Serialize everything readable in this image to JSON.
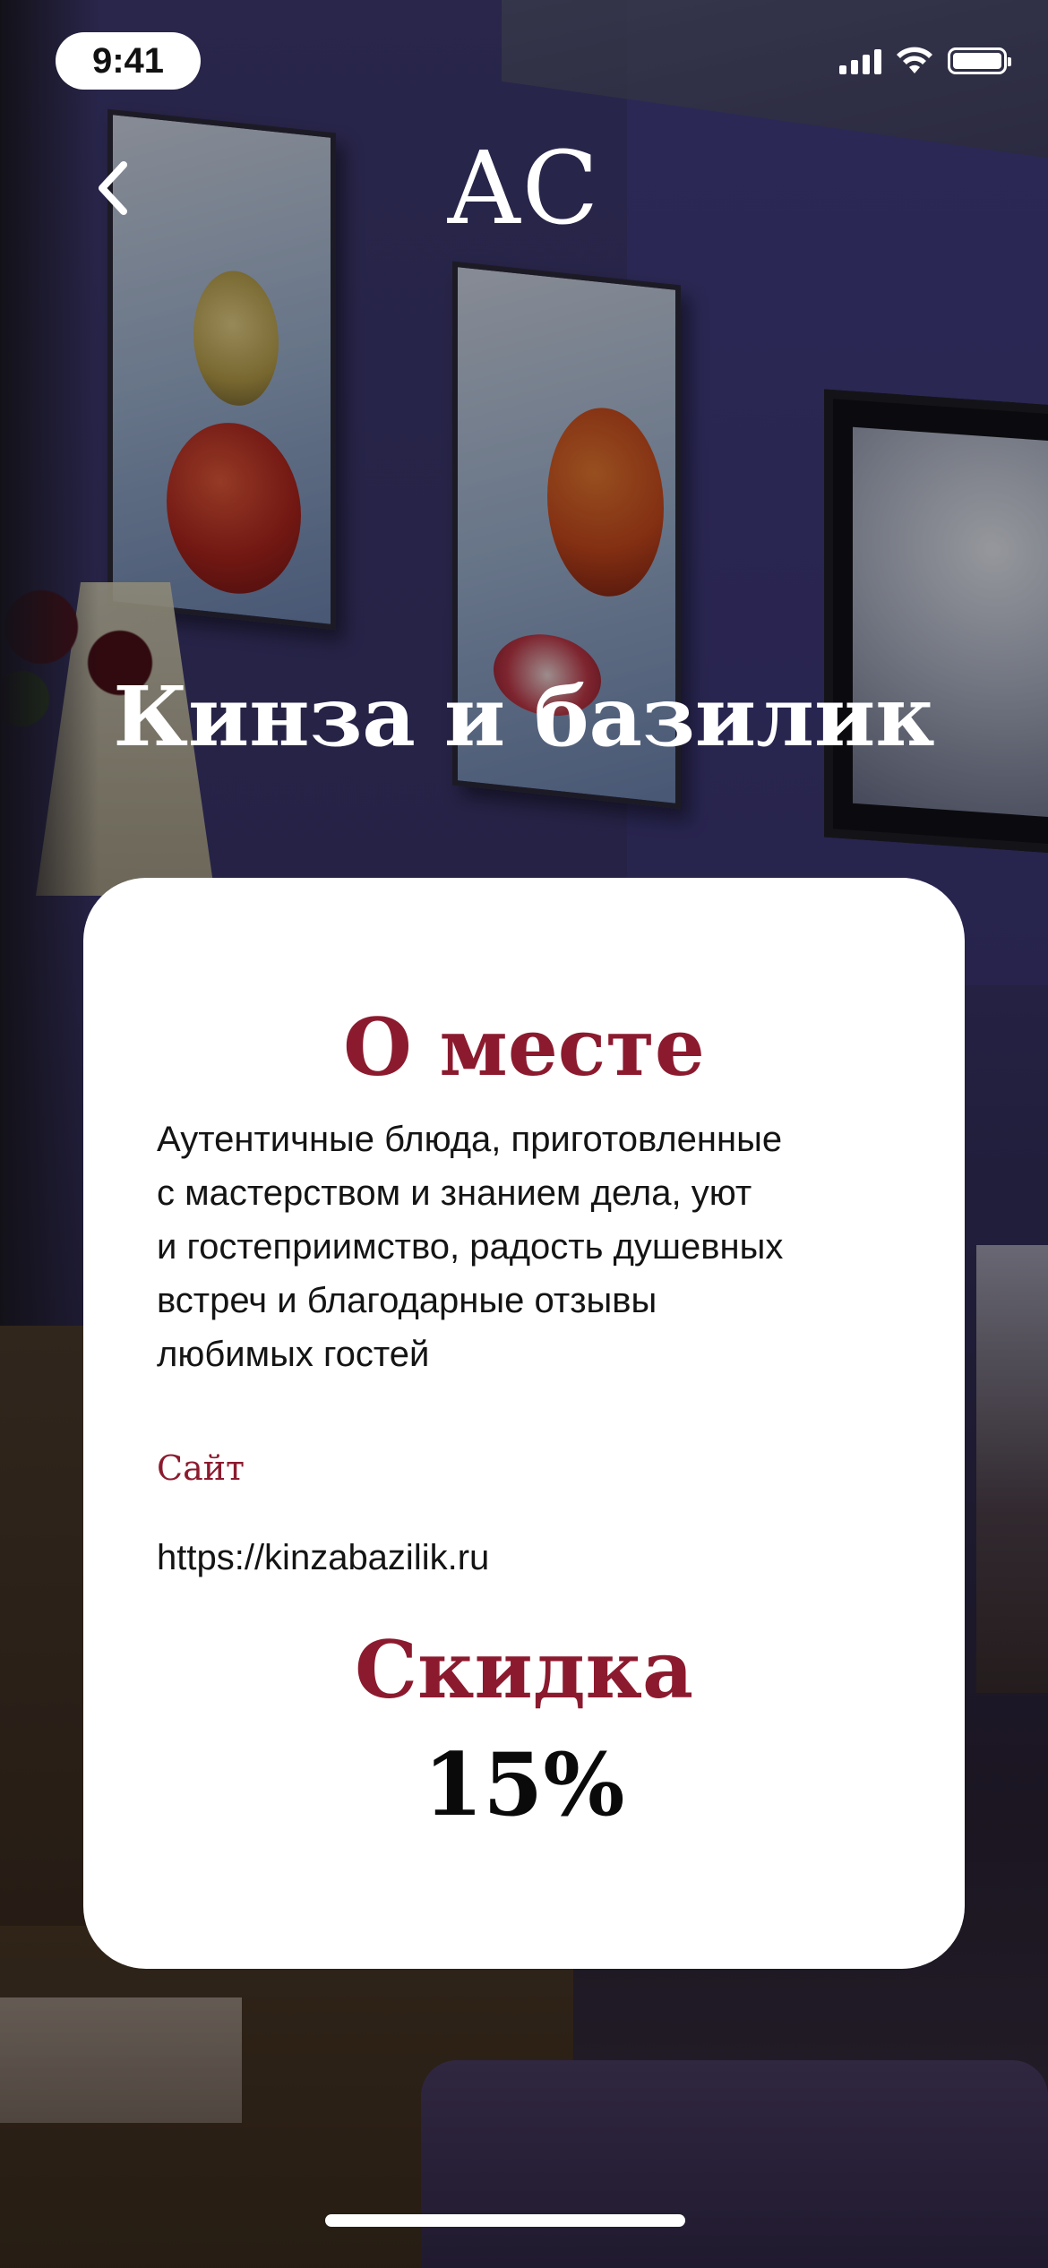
{
  "status_bar": {
    "time": "9:41",
    "icons": [
      "cellular-signal-icon",
      "wifi-icon",
      "battery-icon"
    ]
  },
  "nav": {
    "back_icon": "chevron-left-icon",
    "logo": "AC"
  },
  "venue": {
    "title": "Кинза и базилик"
  },
  "card": {
    "heading": "О месте",
    "description": "Аутентичные блюда, приготовленные\nс мастерством и знанием дела, уют\nи гостеприимство, радость душевных\nвстреч и благодарные отзывы\nлюбимых гостей",
    "site_label": "Сайт",
    "site_url": "https://kinzabazilik.ru",
    "discount_label": "Скидка",
    "discount_value": "15%"
  },
  "colors": {
    "accent": "#8c1a2e",
    "card_bg": "#ffffff",
    "text": "#141414"
  }
}
